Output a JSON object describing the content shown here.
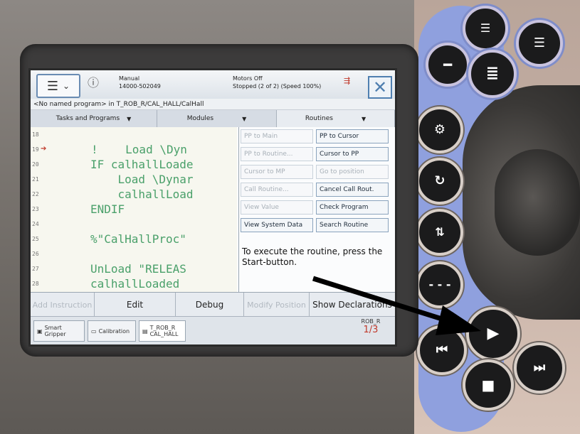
{
  "status": {
    "mode": "Manual",
    "controller_id": "14000-502049",
    "motors": "Motors Off",
    "run_state": "Stopped (2 of 2) (Speed 100%)"
  },
  "path": "<No named program> in T_ROB_R/CAL_HALL/CalHall",
  "tabs": [
    {
      "label": "Tasks and Programs"
    },
    {
      "label": "Modules"
    },
    {
      "label": "Routines"
    }
  ],
  "code_lines": [
    {
      "num": "18",
      "text": ""
    },
    {
      "num": "19",
      "text": "!    Load \\Dyn"
    },
    {
      "num": "20",
      "text": "IF calhallLoade"
    },
    {
      "num": "21",
      "text": "    Load \\Dynar"
    },
    {
      "num": "22",
      "text": "    calhallLoad"
    },
    {
      "num": "23",
      "text": "ENDIF"
    },
    {
      "num": "24",
      "text": ""
    },
    {
      "num": "25",
      "text": "%\"CalHallProc\""
    },
    {
      "num": "26",
      "text": ""
    },
    {
      "num": "27",
      "text": "UnLoad \"RELEAS"
    },
    {
      "num": "28",
      "text": "calhallLoaded"
    }
  ],
  "routine_menu": [
    {
      "label": "PP to Main",
      "enabled": false
    },
    {
      "label": "PP to Cursor",
      "enabled": true
    },
    {
      "label": "PP to Routine...",
      "enabled": false
    },
    {
      "label": "Cursor to PP",
      "enabled": true
    },
    {
      "label": "Cursor to MP",
      "enabled": false
    },
    {
      "label": "Go to position",
      "enabled": false
    },
    {
      "label": "Call Routine...",
      "enabled": false
    },
    {
      "label": "Cancel Call Rout.",
      "enabled": true
    },
    {
      "label": "View Value",
      "enabled": false
    },
    {
      "label": "Check Program",
      "enabled": true
    },
    {
      "label": "View System Data",
      "enabled": true
    },
    {
      "label": "Search Routine",
      "enabled": true
    }
  ],
  "hint": "To execute the routine, press the Start-button.",
  "bottom_bar": {
    "add_instruction": "Add Instruction",
    "edit": "Edit",
    "debug": "Debug",
    "modify_position": "Modify Position",
    "show_declarations": "Show Declarations"
  },
  "taskbar": {
    "item1": "Smart Gripper",
    "item2": "Calibration",
    "item3": "T_ROB_R CAL_HALL",
    "unit": "ROB_R",
    "fraction": "1/3"
  },
  "colors": {
    "code_green": "#4aa06a",
    "hardware_blue": "#8fa0de",
    "arrow": "#000000"
  },
  "icons": {
    "menu": "hamburger-icon",
    "close": "close-icon",
    "start": "play-icon",
    "stop": "stop-icon",
    "step_back": "step-back-icon",
    "step_forward": "step-forward-icon"
  }
}
